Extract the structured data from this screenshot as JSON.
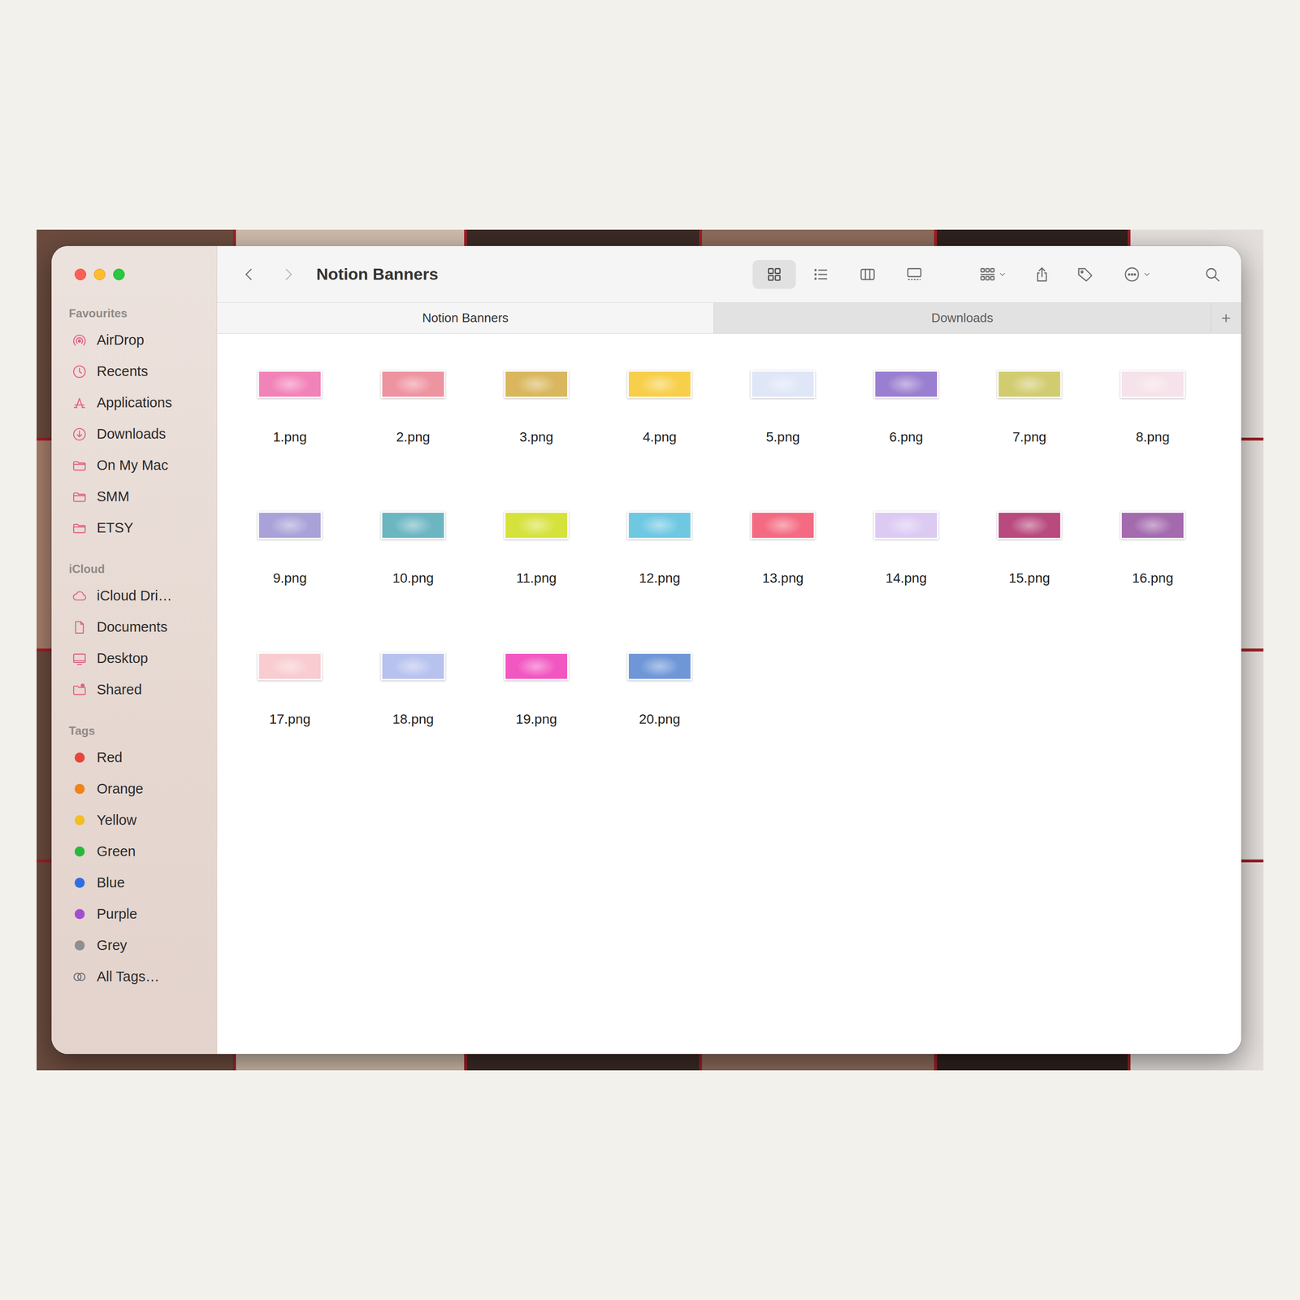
{
  "window": {
    "title": "Notion Banners"
  },
  "toolbar": {
    "nav": [
      {
        "kind": "back",
        "enabled": true
      },
      {
        "kind": "forward",
        "enabled": false
      }
    ],
    "views": [
      {
        "kind": "icons",
        "selected": true
      },
      {
        "kind": "list",
        "selected": false
      },
      {
        "kind": "columns",
        "selected": false
      },
      {
        "kind": "gallery",
        "selected": false
      }
    ]
  },
  "tabs": [
    {
      "label": "Notion Banners",
      "selected": true
    },
    {
      "label": "Downloads",
      "selected": false
    }
  ],
  "new_tab": "+",
  "sidebar": {
    "sections": [
      {
        "heading": "Favourites",
        "items": [
          {
            "label": "AirDrop",
            "kind": "airdrop"
          },
          {
            "label": "Recents",
            "kind": "recents"
          },
          {
            "label": "Applications",
            "kind": "applications"
          },
          {
            "label": "Downloads",
            "kind": "downloads"
          },
          {
            "label": "On My Mac",
            "kind": "folder"
          },
          {
            "label": "SMM",
            "kind": "folder"
          },
          {
            "label": "ETSY",
            "kind": "folder"
          }
        ]
      },
      {
        "heading": "iCloud",
        "items": [
          {
            "label": "iCloud Dri…",
            "kind": "cloud"
          },
          {
            "label": "Documents",
            "kind": "document"
          },
          {
            "label": "Desktop",
            "kind": "desktop"
          },
          {
            "label": "Shared",
            "kind": "shared"
          }
        ]
      },
      {
        "heading": "Tags",
        "items": [
          {
            "label": "Red",
            "kind": "tag",
            "color": "#e8453c"
          },
          {
            "label": "Orange",
            "kind": "tag",
            "color": "#ef8418"
          },
          {
            "label": "Yellow",
            "kind": "tag",
            "color": "#f2be24"
          },
          {
            "label": "Green",
            "kind": "tag",
            "color": "#28b83b"
          },
          {
            "label": "Blue",
            "kind": "tag",
            "color": "#2d6fe0"
          },
          {
            "label": "Purple",
            "kind": "tag",
            "color": "#a14fd0"
          },
          {
            "label": "Grey",
            "kind": "tag",
            "color": "#8e8e93"
          },
          {
            "label": "All Tags…",
            "kind": "all-tags"
          }
        ]
      }
    ]
  },
  "files": [
    {
      "name": "1.png",
      "color": "#f283b8"
    },
    {
      "name": "2.png",
      "color": "#ee93a0"
    },
    {
      "name": "3.png",
      "color": "#d9b75e"
    },
    {
      "name": "4.png",
      "color": "#f7cf4a"
    },
    {
      "name": "5.png",
      "color": "#dfe6f7"
    },
    {
      "name": "6.png",
      "color": "#9a7fd0"
    },
    {
      "name": "7.png",
      "color": "#d2cc70"
    },
    {
      "name": "8.png",
      "color": "#f6e2ea"
    },
    {
      "name": "9.png",
      "color": "#a9a2d8"
    },
    {
      "name": "10.png",
      "color": "#6cb6c2"
    },
    {
      "name": "11.png",
      "color": "#d6e23c"
    },
    {
      "name": "12.png",
      "color": "#6fc8e2"
    },
    {
      "name": "13.png",
      "color": "#f46a82"
    },
    {
      "name": "14.png",
      "color": "#dccaf3"
    },
    {
      "name": "15.png",
      "color": "#b84a7e"
    },
    {
      "name": "16.png",
      "color": "#a46aae"
    },
    {
      "name": "17.png",
      "color": "#f8ccd0"
    },
    {
      "name": "18.png",
      "color": "#b8c2ee"
    },
    {
      "name": "19.png",
      "color": "#f257c1"
    },
    {
      "name": "20.png",
      "color": "#6f97d8"
    }
  ]
}
